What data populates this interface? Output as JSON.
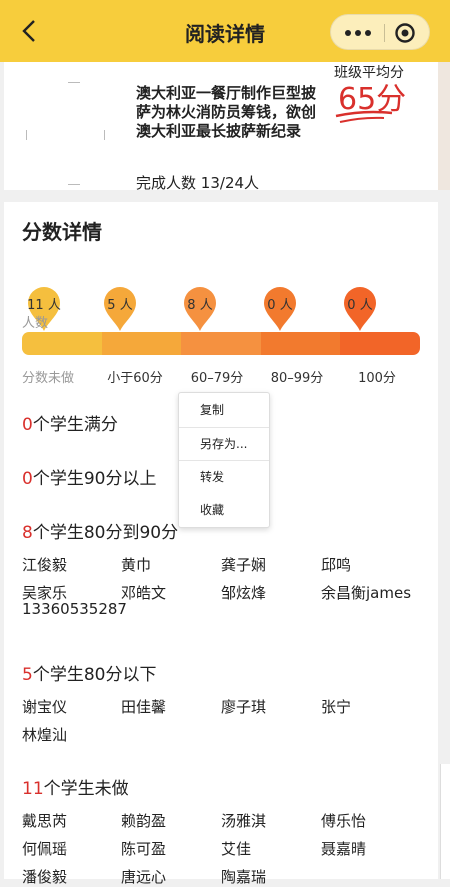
{
  "header": {
    "title": "阅读详情"
  },
  "article": {
    "title": "澳大利亚一餐厅制作巨型披萨为林火消防员筹钱，欲创澳大利亚最长披萨新纪录",
    "completion_label": "完成人数",
    "completion_value": "13/24人"
  },
  "class_average": {
    "label": "班级平均分",
    "score": "65分"
  },
  "score_details": {
    "title": "分数详情",
    "axis_label": "人数",
    "buckets": [
      {
        "label": "分数未做",
        "count": "11 人",
        "color": "#f5bf3e"
      },
      {
        "label": "小于60分",
        "count": "5 人",
        "color": "#f5a83a"
      },
      {
        "label": "60–79分",
        "count": "8 人",
        "color": "#f59140"
      },
      {
        "label": "80–99分",
        "count": "0 人",
        "color": "#f27a2e"
      },
      {
        "label": "100分",
        "count": "0 人",
        "color": "#f26528"
      }
    ]
  },
  "groups": [
    {
      "count": "0",
      "label": "个学生满分",
      "names": []
    },
    {
      "count": "0",
      "label": "个学生90分以上",
      "names": []
    },
    {
      "count": "8",
      "label": "个学生80分到90分",
      "names": [
        "江俊毅",
        "黄巾",
        "龚子娴",
        "邱鸣",
        "吴家乐",
        "邓皓文",
        "邹炫烽",
        "余昌衡james",
        "13360535287"
      ]
    },
    {
      "count": "5",
      "label": "个学生80分以下",
      "names": [
        "谢宝仪",
        "田佳馨",
        "廖子琪",
        "张宁",
        "林煌汕"
      ]
    },
    {
      "count": "11",
      "label": "个学生未做",
      "names": [
        "戴思芮",
        "赖韵盈",
        "汤雅淇",
        "傅乐怡",
        "何佩瑶",
        "陈可盈",
        "艾佳",
        "聂嘉晴",
        "潘俊毅",
        "唐远心",
        "陶嘉瑞"
      ]
    }
  ],
  "context_menu": {
    "items": [
      "复制",
      "另存为...",
      "转发",
      "收藏"
    ]
  },
  "colors": {
    "brand": "#f7cd3c",
    "accent_red": "#d9302c"
  },
  "icons": {
    "back": "back-arrow-icon",
    "more": "more-dots-icon",
    "close": "mini-program-close-icon"
  }
}
